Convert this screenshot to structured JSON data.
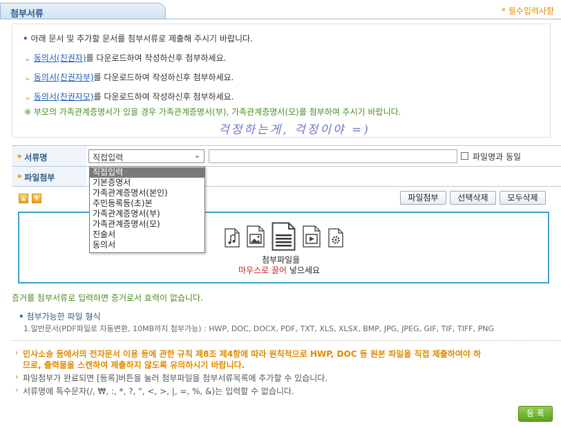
{
  "header": {
    "tab_title": "첨부서류",
    "required_note": "* 필수입력사항"
  },
  "notice": {
    "intro": "아래 문서 및 추가할 문서를 첨부서류로 제출해 주시기 바랍니다.",
    "items": [
      {
        "link": "동의서(친권자)",
        "rest": "를 다운로드하여 작성하신후 첨부하세요."
      },
      {
        "link": "동의서(친권자부)",
        "rest": "를 다운로드하여 작성하신후 첨부하세요."
      },
      {
        "link": "동의서(친권자모)",
        "rest": "를 다운로드하여 작성하신후 첨부하세요."
      }
    ],
    "warning": "※ 부모의 가족관계증명서가 있을 경우 가족관계증명서(부), 가족관계증명서(모)를 첨부하여 주시기 바랍니다."
  },
  "handwriting": "걱정하는게, 걱정이야 =)",
  "form": {
    "doc_name_label": "서류명",
    "attach_label": "파일첨부",
    "star": "*",
    "select_value": "직접입력",
    "same_as_filename": "파일명과 동일",
    "attach_button": "파일첨부",
    "delete_selected_button": "선택삭제",
    "delete_all_button": "모두삭제"
  },
  "dropdown_options": [
    "직접입력",
    "기본증명서",
    "가족관계증명서(본인)",
    "주민등록등(초)본",
    "가족관계증명서(부)",
    "가족관계증명서(모)",
    "진술서",
    "동의서"
  ],
  "dropzone": {
    "line1": "첨부파일을",
    "line2_red": "마우스로 끌어",
    "line2_rest": " 넣으세요"
  },
  "evidence_note": "증거를 첨부서류로 입력하면 증거로서 효력이 없습니다.",
  "formats": {
    "title": "첨부가능한 파일 형식",
    "list": "1.일반문서(PDF파일로 자동변환, 10MB까지 첨부가능) : HWP, DOC, DOCX, PDF, TXT, XLS, XLSX, BMP, JPG, JPEG, GIF, TIF, TIFF, PNG"
  },
  "law_notice": {
    "line1": "민사소송 등에서의 전자문서 이용 등에 관한 규칙 제8조 제4항에 따라 원칙적으로 HWP, DOC 등 원본 파일을 직접 제출하여야 하",
    "line2": "므로, 출력물을 스캔하여 제출하지 않도록 유의하시기 바랍니다."
  },
  "info_lines": [
    "파일첨부가 완료되면 [등록]버튼을 눌러 첨부파일을 첨부서류목록에 추가할 수 있습니다.",
    "서류명에 특수문자(/, ₩, :, *, ?, \", <, >, |, =, %, &)는 입력할 수 없습니다."
  ],
  "register_button": "등 록",
  "colors": {
    "accent_blue": "#2d5c88",
    "link_blue": "#1a5fb4",
    "orange": "#e08a00",
    "green": "#4a8c1c",
    "dropzone_border": "#3ba2cf",
    "register_green": "#5aa21f"
  }
}
